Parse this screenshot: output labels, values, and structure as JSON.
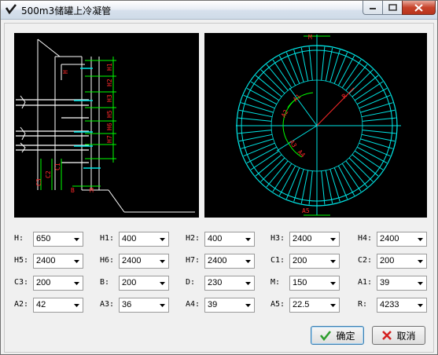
{
  "window": {
    "title": "500m3储罐上冷凝管"
  },
  "left_drawing_labels": [
    "H1",
    "H2",
    "H3",
    "H5",
    "H6",
    "H7",
    "C1",
    "C2",
    "C3",
    "B",
    "H",
    "M"
  ],
  "right_drawing_labels": [
    "M",
    "R",
    "A1",
    "A2",
    "A3",
    "A4",
    "A5"
  ],
  "fields": [
    {
      "label": "H:",
      "value": "650"
    },
    {
      "label": "H1:",
      "value": "400"
    },
    {
      "label": "H2:",
      "value": "400"
    },
    {
      "label": "H3:",
      "value": "2400"
    },
    {
      "label": "H4:",
      "value": "2400"
    },
    {
      "label": "H5:",
      "value": "2400"
    },
    {
      "label": "H6:",
      "value": "2400"
    },
    {
      "label": "H7:",
      "value": "2400"
    },
    {
      "label": "C1:",
      "value": "200"
    },
    {
      "label": "C2:",
      "value": "200"
    },
    {
      "label": "C3:",
      "value": "200"
    },
    {
      "label": "B:",
      "value": "200"
    },
    {
      "label": "D:",
      "value": "230"
    },
    {
      "label": "M:",
      "value": "150"
    },
    {
      "label": "A1:",
      "value": "39"
    },
    {
      "label": "A2:",
      "value": "42"
    },
    {
      "label": "A3:",
      "value": "36"
    },
    {
      "label": "A4:",
      "value": "39"
    },
    {
      "label": "A5:",
      "value": "22.5"
    },
    {
      "label": "R:",
      "value": "4233"
    }
  ],
  "buttons": {
    "ok": "确定",
    "cancel": "取消"
  },
  "colors": {
    "drawing_bg": "#000000",
    "drawing_line": "#ffffff",
    "drawing_cyan": "#00e5e5",
    "drawing_dim": "#ff2a2a",
    "drawing_green": "#00ff00"
  }
}
